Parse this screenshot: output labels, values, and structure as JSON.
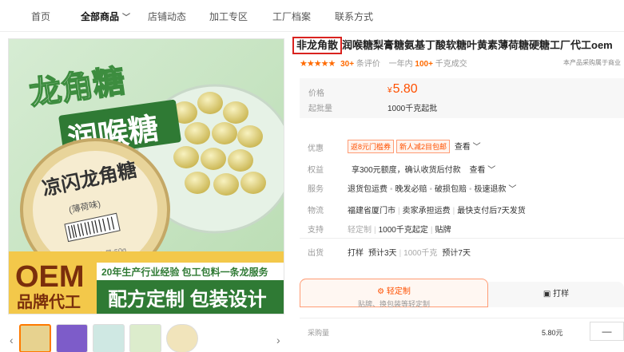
{
  "nav": {
    "items": [
      "首页",
      "全部商品",
      "店铺动态",
      "加工专区",
      "工厂档案",
      "联系方式"
    ]
  },
  "product_image": {
    "headline_1": "龙角糖",
    "headline_2": "润喉糖",
    "can_brand": "凉闪龙角糖",
    "can_sub": "(薄荷味)",
    "can_weight": "净含量:50g",
    "oem_big": "OEM",
    "oem_small": "品牌代工",
    "banner_top": "20年生产行业经验 包工包料一条龙服务",
    "banner_main": "配方定制 包装设计"
  },
  "title": {
    "highlight": "非龙角散",
    "rest": "润喉糖梨膏糖氨基丁酸软糖叶黄素薄荷糖硬糖工厂代工oem"
  },
  "rating": {
    "stars": "★★★★★",
    "reviews_count": "30+",
    "reviews_label": "条评价",
    "sales_prefix": "一年内",
    "sales_count": "100+",
    "sales_suffix": "千克成交",
    "note": "本产品采购属于商业"
  },
  "price": {
    "price_label": "价格",
    "currency": "¥",
    "price_value": "5.80",
    "moq_label": "起批量",
    "moq_value": "1000千克起批"
  },
  "attributes": {
    "discount_label": "优惠",
    "discount_tag1": "返8元门槛券",
    "discount_tag2": "新人减2目包邮",
    "view_label": "查看",
    "rights_label": "权益",
    "rights_value": "享300元额度，确认收货后付款",
    "service_label": "服务",
    "service_values": [
      "退货包运费",
      "晚发必赔",
      "破损包赔",
      "极速退款"
    ],
    "logistics_label": "物流",
    "logistics_values": [
      "福建省厦门市",
      "卖家承担运费",
      "最快支付后7天发货"
    ],
    "support_label": "支持",
    "support_values": [
      "轻定制",
      "1000千克起定",
      "贴牌"
    ],
    "ship_label": "出货",
    "ship_values": [
      "打样",
      "预计3天",
      "1000千克",
      "预计7天"
    ]
  },
  "actions": {
    "custom_label": "轻定制",
    "custom_sub": "贴牌、换包装等轻定制",
    "sample_label": "打样"
  },
  "purchase": {
    "qty_label": "采购量",
    "unit_price": "5.80元",
    "minus": "—"
  }
}
